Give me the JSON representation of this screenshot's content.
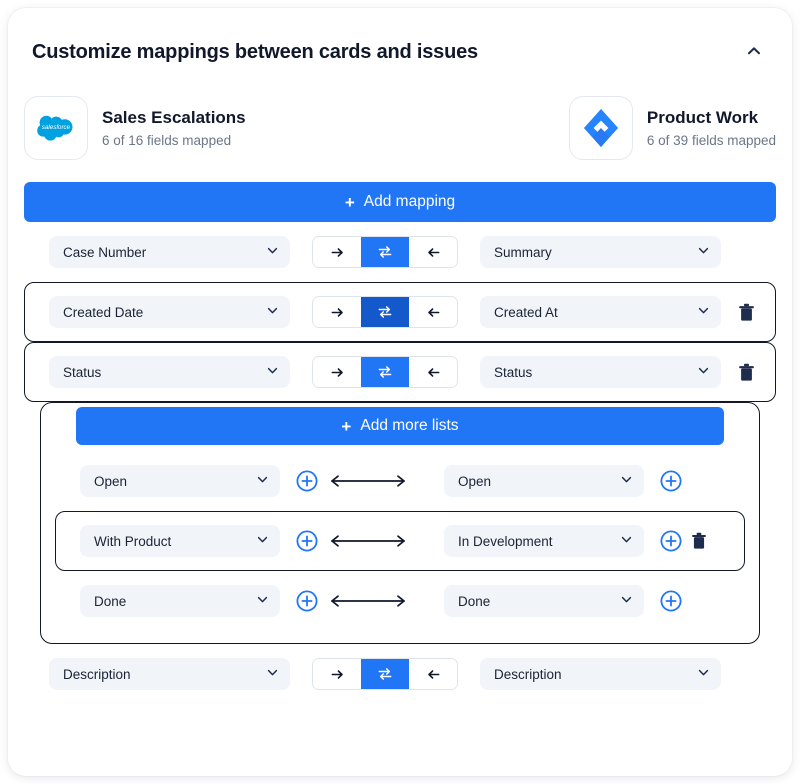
{
  "header": {
    "title": "Customize mappings between cards and issues",
    "collapse_icon": "chevron-up-icon"
  },
  "connectors": {
    "left": {
      "logo": "salesforce-logo",
      "name": "Sales Escalations",
      "fields_mapped": "6 of 16 fields mapped"
    },
    "right": {
      "logo": "jira-logo",
      "name": "Product Work",
      "fields_mapped": "6 of 39 fields mapped"
    }
  },
  "actions": {
    "add_mapping_label": "Add mapping",
    "add_more_lists_label": "Add more lists",
    "plus_glyph": "+"
  },
  "direction_control": {
    "right_icon": "arrow-right-icon",
    "both_icon": "arrow-swap-icon",
    "left_icon": "arrow-left-icon",
    "right_glyph": "→",
    "both_glyph": "⇄",
    "left_glyph": "←"
  },
  "colors": {
    "accent": "#2176f5",
    "accent_dark": "#1459cc",
    "field_bg": "#f1f4f9",
    "text": "#12182b",
    "muted": "#6b7689",
    "outline": "#111827",
    "salesforce": "#00a1e0",
    "jira": "#2684ff"
  },
  "mappings": [
    {
      "left_field": "Case Number",
      "right_field": "Summary",
      "direction": "both",
      "outlined": false,
      "deletable": false,
      "accent": "normal"
    },
    {
      "left_field": "Created Date",
      "right_field": "Created At",
      "direction": "both",
      "outlined": true,
      "deletable": true,
      "accent": "dark"
    },
    {
      "left_field": "Status",
      "right_field": "Status",
      "direction": "both",
      "outlined": true,
      "deletable": true,
      "accent": "normal"
    },
    {
      "left_field": "Description",
      "right_field": "Description",
      "direction": "both",
      "outlined": false,
      "deletable": false,
      "accent": "normal"
    }
  ],
  "status_values": [
    {
      "left_value": "Open",
      "right_value": "Open",
      "outlined": false,
      "deletable": false
    },
    {
      "left_value": "With Product",
      "right_value": "In Development",
      "outlined": true,
      "deletable": true
    },
    {
      "left_value": "Done",
      "right_value": "Done",
      "outlined": false,
      "deletable": false
    }
  ]
}
